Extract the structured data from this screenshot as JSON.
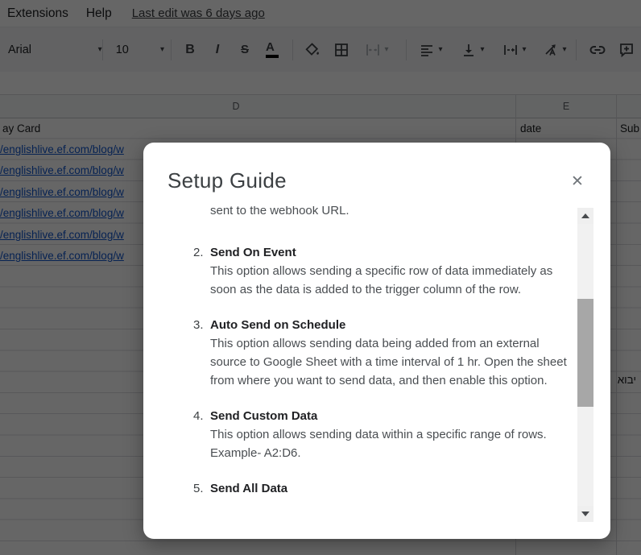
{
  "menubar": {
    "items": [
      {
        "label": "Extensions"
      },
      {
        "label": "Help"
      }
    ],
    "last_edit": "Last edit was 6 days ago"
  },
  "toolbar": {
    "font_name": "Arial",
    "font_size": "10",
    "bold_label": "B",
    "italic_label": "I",
    "strikethrough_label": "S",
    "text_color_label": "A",
    "icons": [
      "font-dropdown",
      "font-size-dropdown",
      "bold",
      "italic",
      "strikethrough",
      "text-color",
      "fill-color",
      "borders",
      "merge-cells",
      "horizontal-align",
      "vertical-align",
      "text-wrap",
      "text-rotation",
      "insert-link",
      "insert-comment"
    ]
  },
  "sheet": {
    "column_headers": [
      "D",
      "E"
    ],
    "row1": {
      "d": "ay Card",
      "e": "date",
      "f": "Sub"
    },
    "links": [
      "/englishlive.ef.com/blog/w",
      "/englishlive.ef.com/blog/w",
      "/englishlive.ef.com/blog/w",
      "/englishlive.ef.com/blog/w",
      "/englishlive.ef.com/blog/w",
      "/englishlive.ef.com/blog/w"
    ],
    "rtl_cell": "יבוא"
  },
  "modal": {
    "title": "Setup Guide",
    "close_glyph": "✕",
    "sections": [
      {
        "num": "",
        "title": "",
        "body": "sent to the webhook URL."
      },
      {
        "num": "2.",
        "title": "Send On Event",
        "body": "This option allows sending a specific row of data immediately as soon as the data is added to the trigger column of the row."
      },
      {
        "num": "3.",
        "title": "Auto Send on Schedule",
        "body": "This option allows sending data being added from an external source to Google Sheet with a time interval of 1 hr. Open the sheet from where you want to send data, and then enable this option."
      },
      {
        "num": "4.",
        "title": "Send Custom Data",
        "body": "This option allows sending data within a specific range of rows. Example- A2:D6."
      },
      {
        "num": "5.",
        "title": "Send All Data",
        "body": ""
      }
    ]
  },
  "colors": {
    "link": "#1155cc",
    "scrim": "rgba(0,0,0,0.60)",
    "modal_bg": "#ffffff",
    "scrollbar_track": "#f1f1f1",
    "scrollbar_thumb": "#a7a7a7",
    "header_bg": "#f8f9fa"
  }
}
